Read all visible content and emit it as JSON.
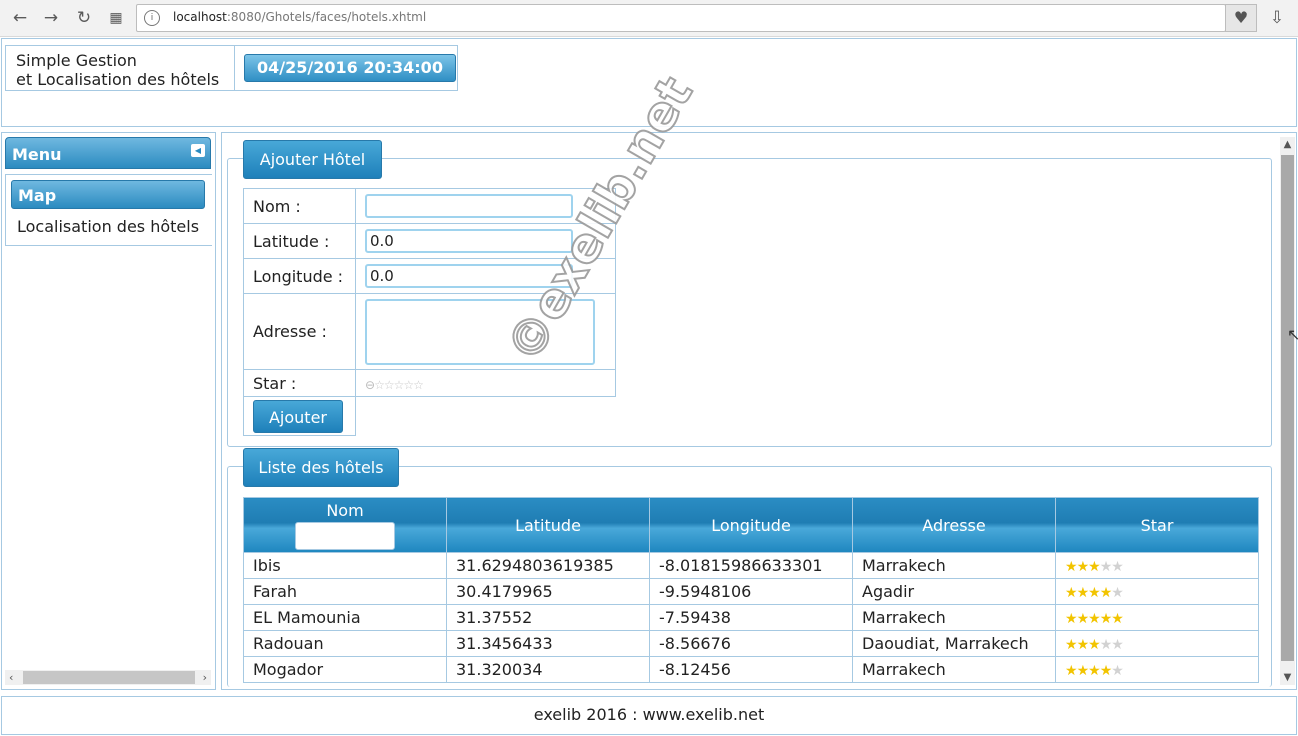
{
  "browser": {
    "url_host": "localhost",
    "url_rest": ":8080/Ghotels/faces/hotels.xhtml"
  },
  "header": {
    "title_line1": "Simple Gestion",
    "title_line2": "et Localisation des hôtels",
    "datetime": "04/25/2016 20:34:00"
  },
  "menu": {
    "title": "Menu",
    "section": "Map",
    "item": "Localisation des hôtels"
  },
  "form": {
    "legend": "Ajouter Hôtel",
    "nom_label": "Nom :",
    "nom_value": "",
    "latitude_label": "Latitude :",
    "latitude_value": "0.0",
    "longitude_label": "Longitude :",
    "longitude_value": "0.0",
    "adresse_label": "Adresse :",
    "star_label": "Star :",
    "submit_label": "Ajouter"
  },
  "list": {
    "legend": "Liste des hôtels",
    "columns": [
      "Nom",
      "Latitude",
      "Longitude",
      "Adresse",
      "Star"
    ],
    "rows": [
      {
        "nom": "Ibis",
        "latitude": "31.6294803619385",
        "longitude": "-8.01815986633301",
        "adresse": "Marrakech",
        "stars": 3
      },
      {
        "nom": "Farah",
        "latitude": "30.4179965",
        "longitude": "-9.5948106",
        "adresse": "Agadir",
        "stars": 4
      },
      {
        "nom": "EL Mamounia",
        "latitude": "31.37552",
        "longitude": "-7.59438",
        "adresse": "Marrakech",
        "stars": 5
      },
      {
        "nom": "Radouan",
        "latitude": "31.3456433",
        "longitude": "-8.56676",
        "adresse": "Daoudiat, Marrakech",
        "stars": 3
      },
      {
        "nom": "Mogador",
        "latitude": "31.320034",
        "longitude": "-8.12456",
        "adresse": "Marrakech",
        "stars": 4
      }
    ]
  },
  "watermark": "©exelib.net",
  "footer": "exelib 2016 : www.exelib.net"
}
